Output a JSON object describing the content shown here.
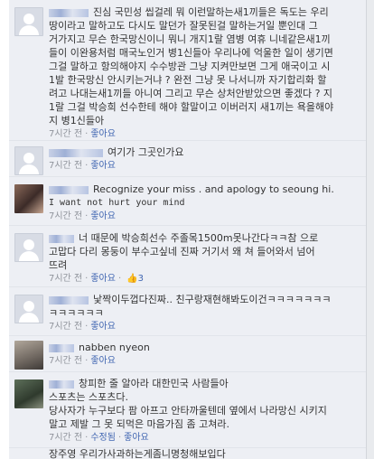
{
  "comments": [
    {
      "avatar": "default-avatar",
      "lines": [
        "진심 국민성 씹걸레 뭐 이런말하는새1끼들은 독도는 우리",
        "땅이라고 말하고도 다시도 말던가 잘못된걸 말하는거일 뿐인대 그",
        "거가지고 무슨 한국망신이니 뭐니 개지1랄 염병 여휴 니네같은새1끼",
        "들이 이완용처럼 매국노인거 병1신들아 우리나에 억울한 일이 생기면",
        "그걸 말하고 항의해야지 수수방관 그냥 지켜만보면 그게 애국이고 시",
        "1발 한국망신 안시키는거냐 ? 완전 그냥 못 나서니까 자기합리화 할",
        "려고 나대는새1끼들 아니여 그리고 무슨 상처안받았으면 좋겠다 ? 지",
        "1랄 그걸 박승희 선수한테 해야 할말이고 이버러지 새1끼는 욕을해야",
        "지 병1신들아"
      ],
      "meta": {
        "time": "7시간 전",
        "like": "좋아요"
      }
    },
    {
      "avatar": "default-avatar",
      "lines": [
        "여기가 그곳인가요"
      ],
      "meta": {
        "time": "7시간 전",
        "like": "좋아요"
      }
    },
    {
      "avatar": "photo-avatar",
      "lines": [
        "Recognize your miss . and apology to seoung hi.",
        "I want not hurt your mind"
      ],
      "meta": {
        "time": "7시간 전",
        "like": "좋아요"
      }
    },
    {
      "avatar": "default-avatar",
      "lines": [
        "너 때문에 박승희선수 주졸목1500m못나간다ㅋㅋ참 으로",
        "고맙다 다리 몽둥이 부수고싶네 진짜 거기서 왜 쳐 들어와서 넘어",
        "뜨려"
      ],
      "meta": {
        "time": "7시간 전",
        "like": "좋아요",
        "likes": "3"
      }
    },
    {
      "avatar": "default-avatar",
      "lines": [
        "낯짝이두껍다진짜.. 친구랑재현해봐도이건ㅋㅋㅋㅋㅋㅋㅋ",
        "ㅋㅋㅋㅋㅋㅋ"
      ],
      "meta": {
        "time": "7시간 전",
        "like": "좋아요"
      }
    },
    {
      "avatar": "photo-avatar",
      "lines": [
        "nabben nyeon"
      ],
      "meta": {
        "time": "7시간 전",
        "like": "좋아요"
      }
    },
    {
      "avatar": "photo-avatar",
      "lines": [
        "창피한 줄 알아라 대한민국 사람들아",
        "스포츠는 스포츠다.",
        "당사자가 누구보다 팜 아프고 안타까울텐데 옆에서 나라망신 시키지",
        "말고 제발 그 못 되먹은 마음가짐 좀 고쳐라."
      ],
      "meta": {
        "time": "7시간 전",
        "edited": "수정됨",
        "like": "좋아요"
      }
    },
    {
      "avatar": "default-avatar",
      "lines": [
        "장주영 우리가사과하는게좀니명청해보입다"
      ],
      "meta": {
        "time": "",
        "like": ""
      }
    }
  ]
}
